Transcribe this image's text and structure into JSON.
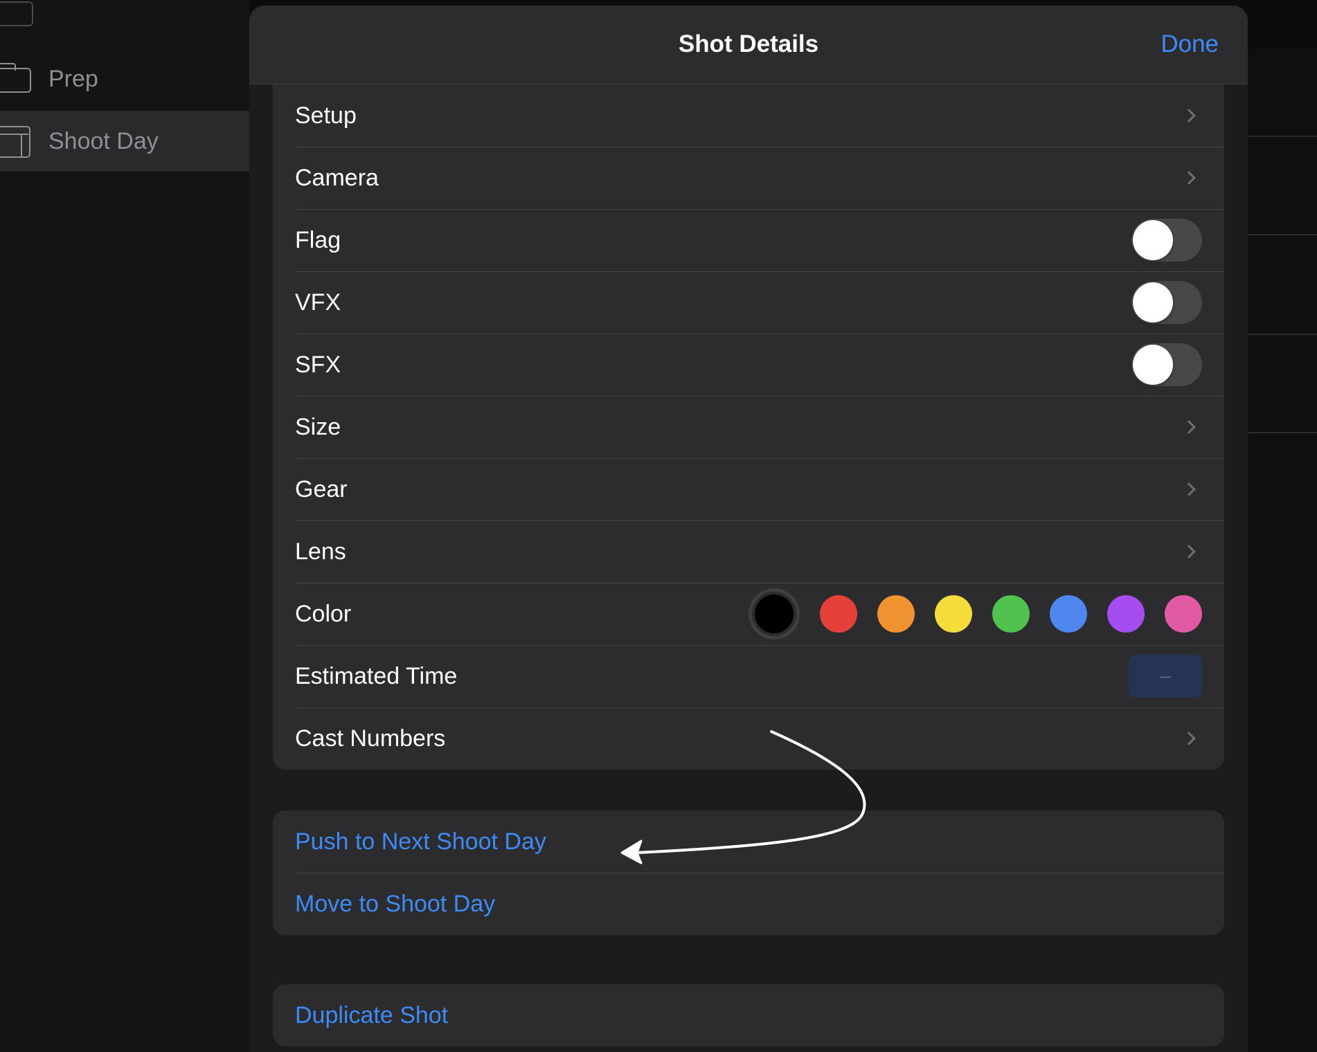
{
  "sidebar": {
    "items": [
      {
        "label": "Prep",
        "icon": "folder-icon"
      },
      {
        "label": "Shoot Day",
        "icon": "film-icon"
      }
    ]
  },
  "sheet": {
    "title": "Shot Details",
    "done_label": "Done"
  },
  "details": {
    "setup": "Setup",
    "camera": "Camera",
    "flag": "Flag",
    "vfx": "VFX",
    "sfx": "SFX",
    "size": "Size",
    "gear": "Gear",
    "lens": "Lens",
    "color": "Color",
    "estimated_time": "Estimated Time",
    "estimated_time_value": "–",
    "cast_numbers": "Cast Numbers"
  },
  "toggles": {
    "flag": false,
    "vfx": false,
    "sfx": false
  },
  "colors": {
    "selected": "#000000",
    "options": [
      "#000000",
      "#e5403a",
      "#f0922f",
      "#f6dc3a",
      "#4fc24f",
      "#4f86ef",
      "#a64df2",
      "#e25aa4"
    ],
    "accent": "#3c8bf7"
  },
  "actions": {
    "push_next": "Push to Next Shoot Day",
    "move_to": "Move to Shoot Day",
    "duplicate": "Duplicate Shot"
  }
}
